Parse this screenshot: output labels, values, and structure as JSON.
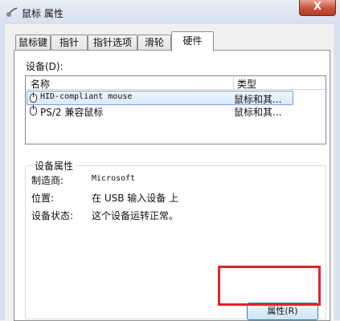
{
  "window": {
    "title": "鼠标 属性",
    "close_label": "X"
  },
  "tabs": [
    {
      "label": "鼠标键",
      "active": false
    },
    {
      "label": "指针",
      "active": false
    },
    {
      "label": "指针选项",
      "active": false
    },
    {
      "label": "滑轮",
      "active": false
    },
    {
      "label": "硬件",
      "active": true
    }
  ],
  "devices": {
    "section_label": "设备(D):",
    "columns": [
      "名称",
      "类型"
    ],
    "rows": [
      {
        "name": "HID-compliant mouse",
        "type": "鼠标和其...",
        "selected": true
      },
      {
        "name": "PS/2 兼容鼠标",
        "type": "鼠标和其...",
        "selected": false
      }
    ]
  },
  "properties": {
    "group_label": "设备属性",
    "fields": [
      {
        "label": "制造商:",
        "value": "Microsoft"
      },
      {
        "label": "位置:",
        "value": "在 USB 输入设备 上"
      },
      {
        "label": "设备状态:",
        "value": "这个设备运转正常。"
      }
    ],
    "button_label": "属性(R)"
  },
  "colors": {
    "highlight": "#e0242a",
    "selection": "#d9e9fb"
  }
}
